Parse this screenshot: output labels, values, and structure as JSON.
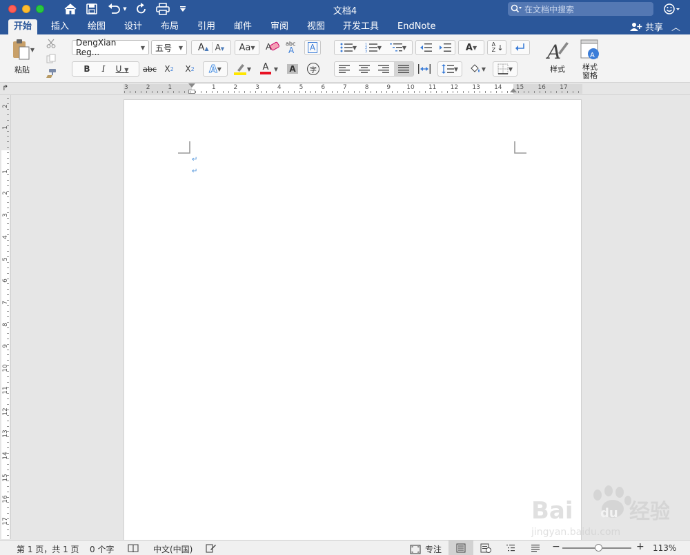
{
  "window": {
    "title": "文档4"
  },
  "search": {
    "placeholder": "在文档中搜索"
  },
  "tabs": [
    {
      "label": "开始",
      "active": true
    },
    {
      "label": "插入"
    },
    {
      "label": "绘图"
    },
    {
      "label": "设计"
    },
    {
      "label": "布局"
    },
    {
      "label": "引用"
    },
    {
      "label": "邮件"
    },
    {
      "label": "审阅"
    },
    {
      "label": "视图"
    },
    {
      "label": "开发工具"
    },
    {
      "label": "EndNote"
    }
  ],
  "share": {
    "label": "共享"
  },
  "ribbon": {
    "paste_label": "粘贴",
    "font_name": "DengXian Reg...",
    "font_size": "五号",
    "styles_label": "样式",
    "styles_pane_label_1": "样式",
    "styles_pane_label_2": "窗格",
    "bold": "B",
    "italic": "I",
    "underline": "U",
    "strike": "abc",
    "sub": "X",
    "sub_small": "2",
    "sup": "X",
    "sup_small": "2",
    "char_shading": "A",
    "enclosed_char": "字",
    "grow_font": "A",
    "shrink_font": "A",
    "change_case": "Aa",
    "phonetic": "abc",
    "char_border": "A",
    "font_color": "A",
    "text_effects": "A",
    "sort": "A Z",
    "text_dir": "A"
  },
  "ruler": {
    "h_numbers": [
      "3",
      "2",
      "1",
      "1",
      "2",
      "3",
      "4",
      "5",
      "6",
      "7",
      "8",
      "9",
      "10",
      "11",
      "12",
      "13",
      "14",
      "15",
      "16",
      "17"
    ],
    "v_numbers": [
      "2",
      "1",
      "1",
      "2",
      "3",
      "4",
      "5",
      "6",
      "7",
      "8",
      "9",
      "10",
      "11",
      "12",
      "13",
      "14",
      "15",
      "16",
      "17"
    ]
  },
  "statusbar": {
    "page": "第 1 页，共 1 页",
    "words": "0 个字",
    "language": "中文(中国)",
    "focus": "专注",
    "zoom": "113%",
    "zoom_minus": "−",
    "zoom_plus": "+"
  },
  "watermark": {
    "brand": "Bai du 经验",
    "url": "jingyan.baidu.com"
  },
  "colors": {
    "brand": "#2b579a",
    "highlight": "#ffe600",
    "font_color_bar": "#e81123",
    "text_effect": "#4a90e2"
  }
}
